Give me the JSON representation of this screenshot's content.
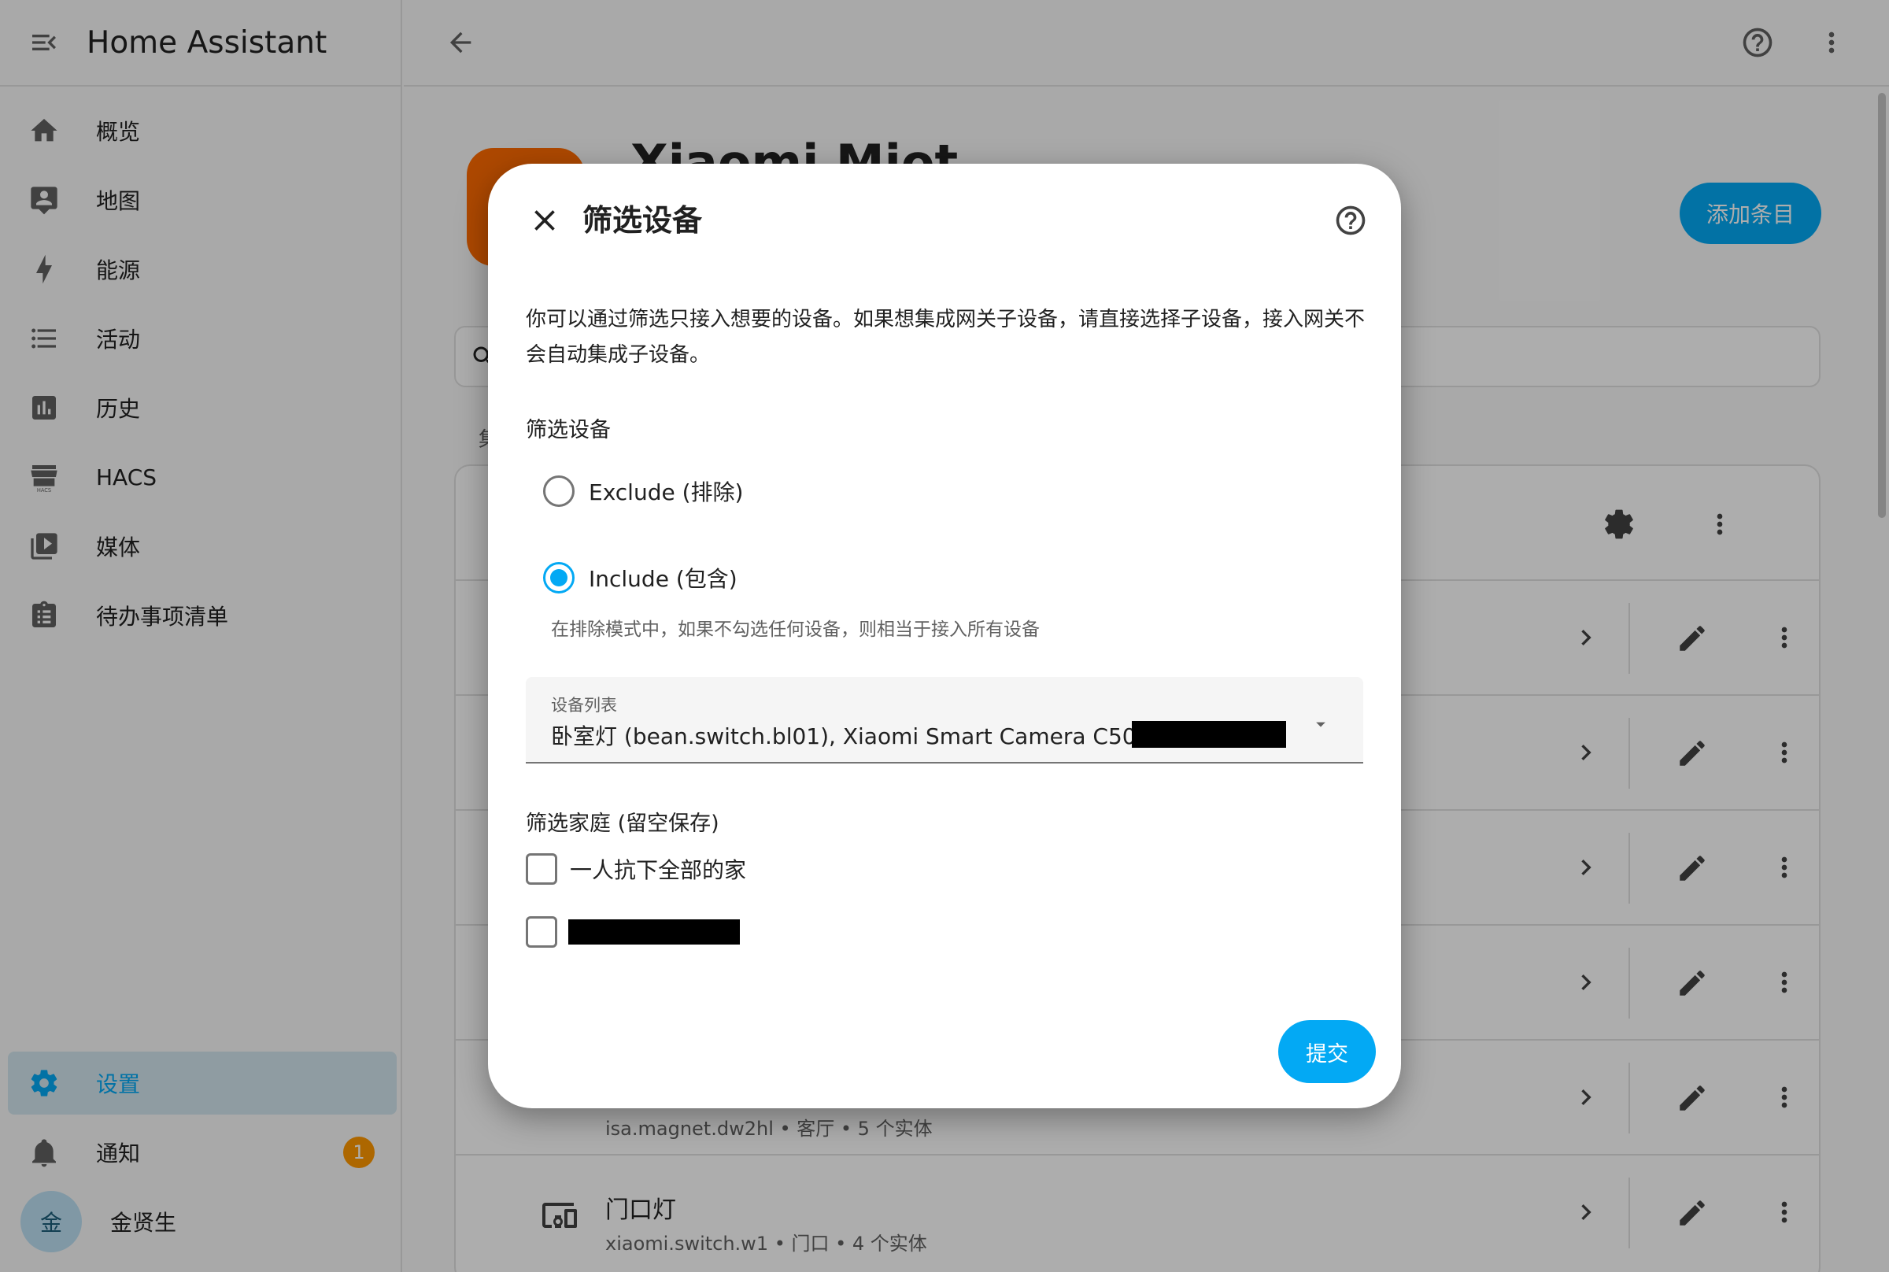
{
  "sidebar": {
    "title": "Home Assistant",
    "items": [
      {
        "label": "概览",
        "icon": "home-icon"
      },
      {
        "label": "地图",
        "icon": "map-account-icon"
      },
      {
        "label": "能源",
        "icon": "lightning-bolt-icon"
      },
      {
        "label": "活动",
        "icon": "list-icon"
      },
      {
        "label": "历史",
        "icon": "chart-box-icon"
      },
      {
        "label": "HACS",
        "icon": "hacs-store-icon"
      },
      {
        "label": "媒体",
        "icon": "play-box-icon"
      },
      {
        "label": "待办事项清单",
        "icon": "clipboard-list-icon"
      }
    ],
    "settings": {
      "label": "设置"
    },
    "notifications": {
      "label": "通知",
      "count": "1"
    },
    "user": {
      "initial": "金",
      "name": "金贤生"
    }
  },
  "page": {
    "title": "Xiaomi Miot",
    "add_button": "添加条目",
    "section_label": "集",
    "rows": [
      {
        "title": "",
        "subtitle": "isa.magnet.dw2hl • 客厅 • 5 个实体"
      },
      {
        "title": "门口灯",
        "subtitle": "xiaomi.switch.w1 • 门口 • 4 个实体"
      }
    ]
  },
  "dialog": {
    "title": "筛选设备",
    "description": "你可以通过筛选只接入想要的设备。如果想集成网关子设备，请直接选择子设备，接入网关不会自动集成子设备。",
    "filter_label": "筛选设备",
    "radio_exclude": "Exclude (排除)",
    "radio_include": "Include (包含)",
    "selected_mode": "include",
    "helper_text": "在排除模式中，如果不勾选任何设备，则相当于接入所有设备",
    "device_list": {
      "caption": "设备列表",
      "value": "卧室灯 (bean.switch.bl01), Xiaomi Smart Camera C500 Pro"
    },
    "home_filter_label": "筛选家庭 (留空保存)",
    "homes": [
      {
        "label": "一人抗下全部的家",
        "checked": false
      },
      {
        "label": "",
        "checked": false,
        "redacted": true
      }
    ],
    "submit": "提交"
  },
  "colors": {
    "accent": "#03a9f4",
    "badge": "#ff9800",
    "brand": "#ff6a00"
  }
}
